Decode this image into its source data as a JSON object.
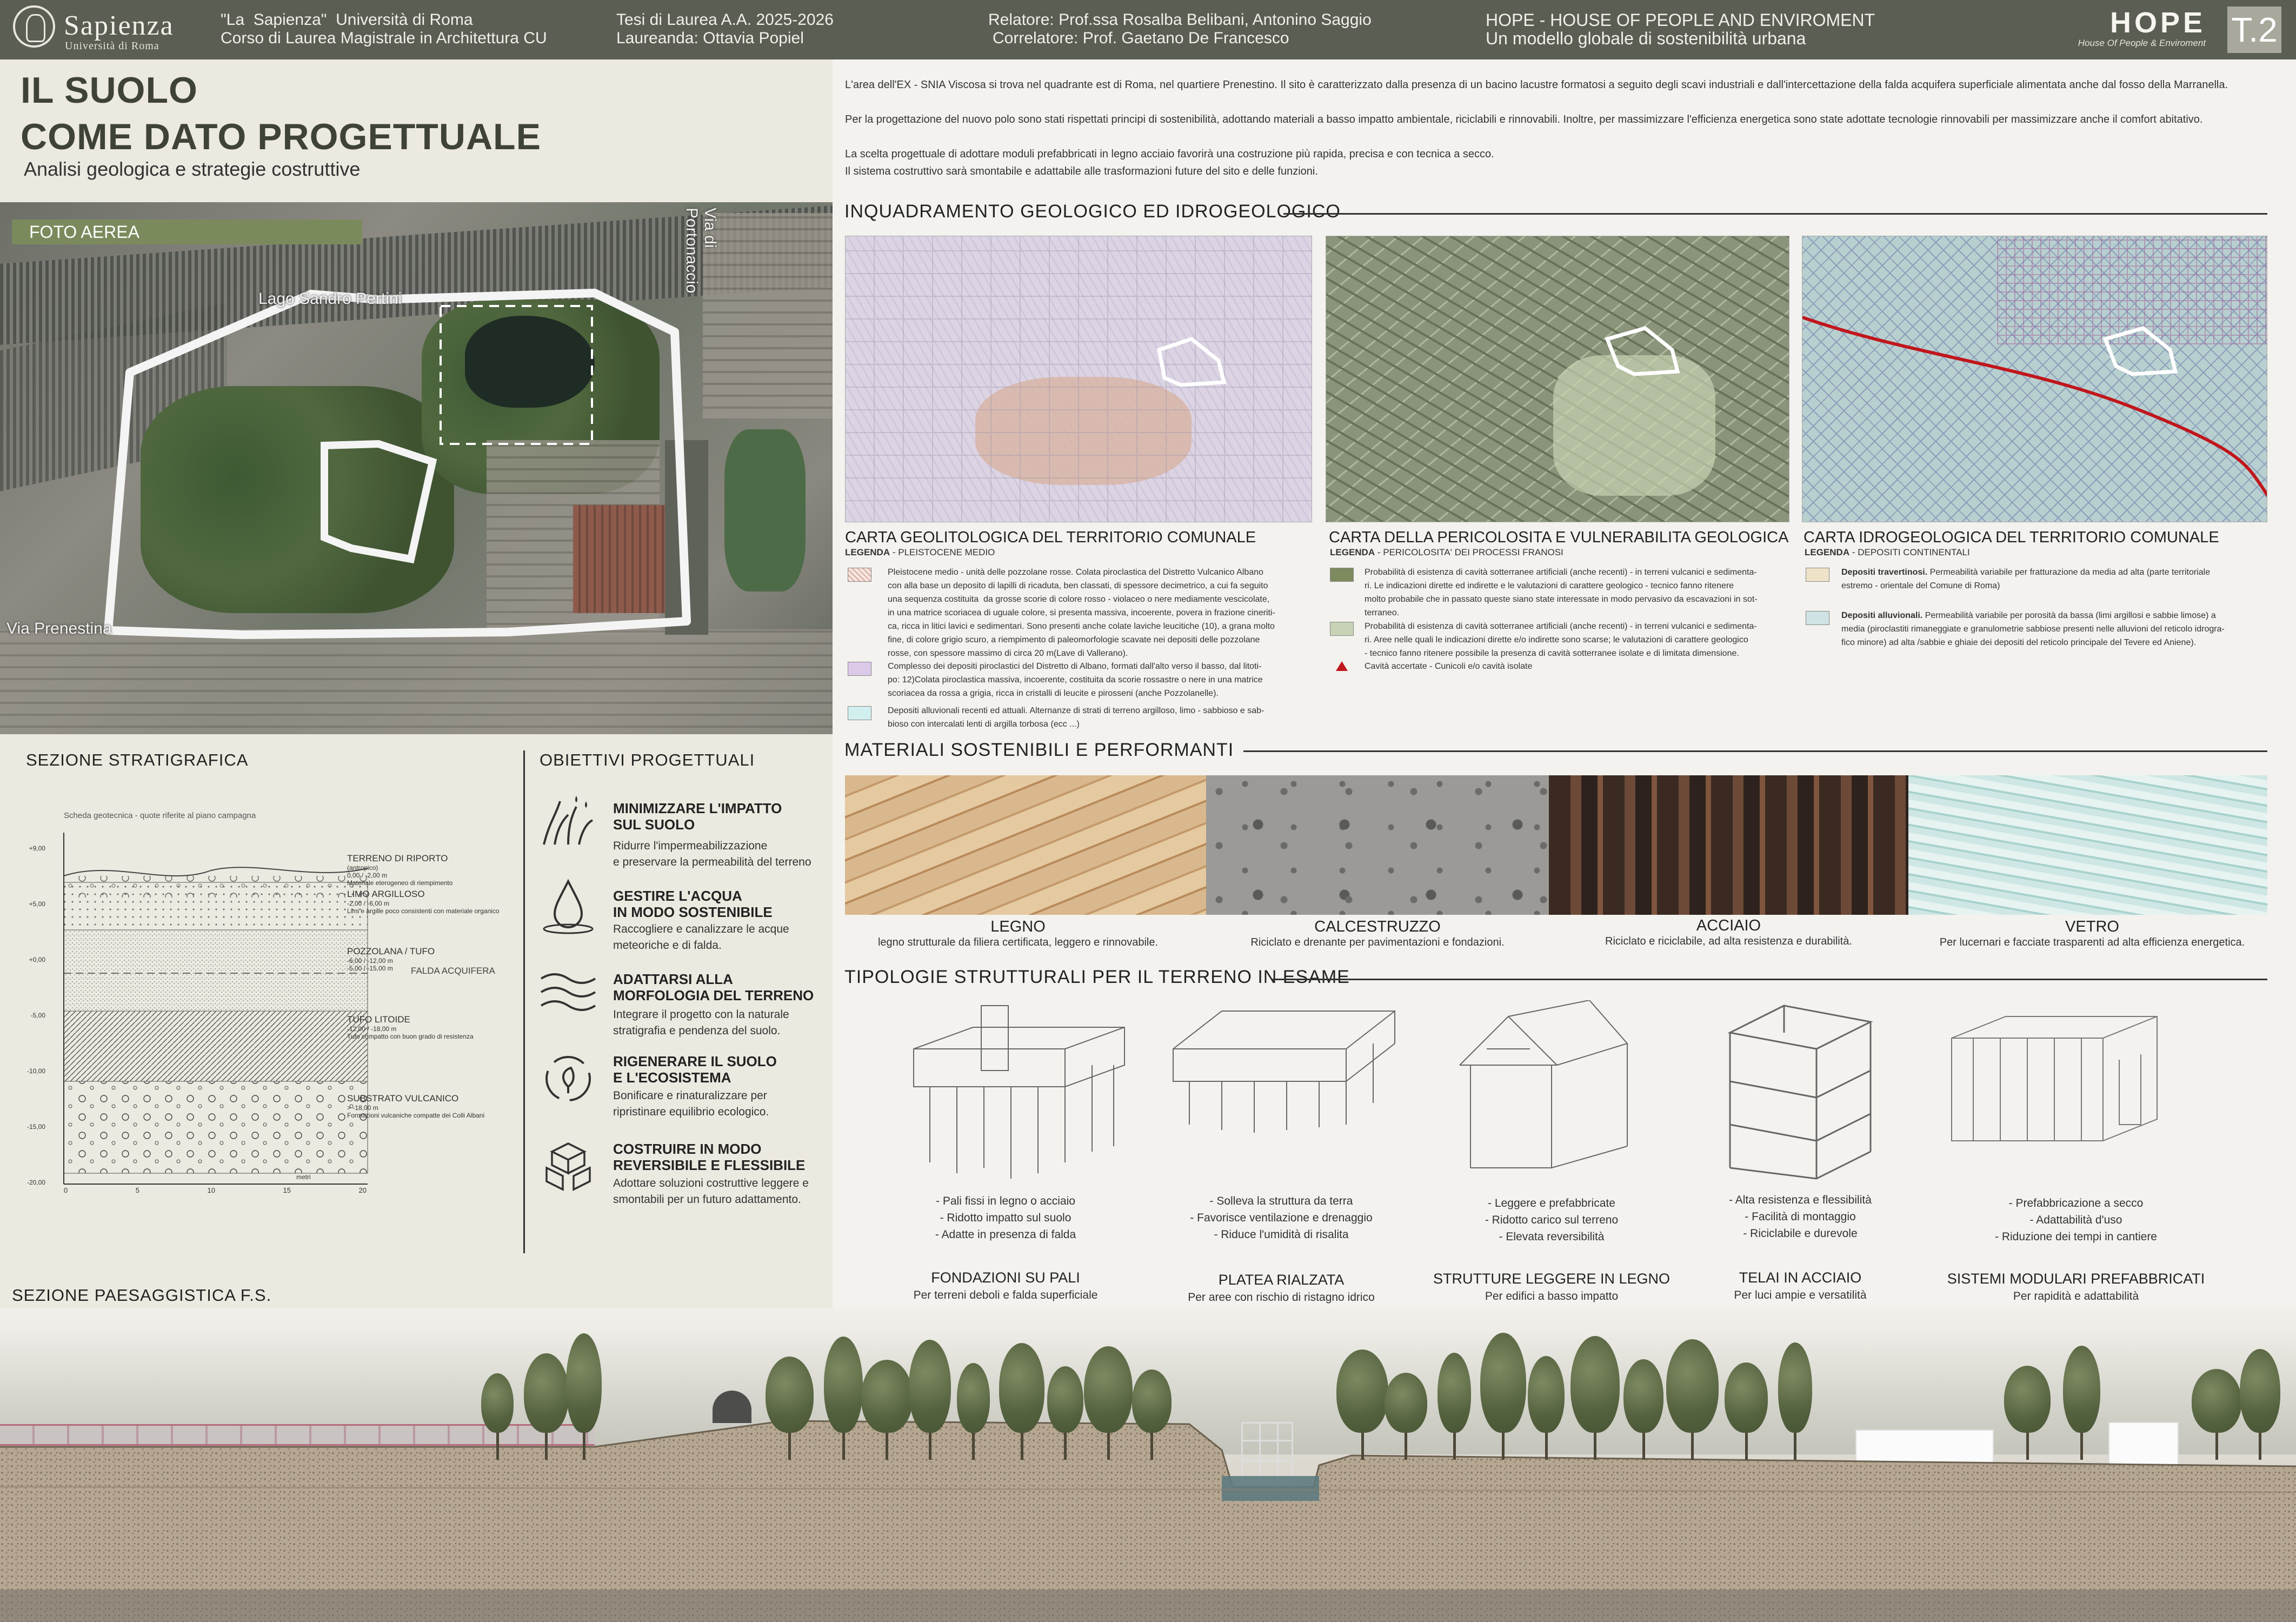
{
  "header": {
    "university_name": "Sapienza",
    "university_sub": "Università di Roma",
    "uni_line1": "\"La  Sapienza\"  Università di Roma",
    "uni_line2": "Corso di Laurea Magistrale in Architettura CU",
    "thesis_line1": "Tesi di Laurea A.A. 2025-2026",
    "thesis_line2": "Laureanda: Ottavia Popiel",
    "relatore_line1": "Relatore: Prof.ssa Rosalba Belibani, Antonino Saggio",
    "relatore_line2": "Correlatore: Prof. Gaetano De Francesco",
    "project_line1": "HOPE - HOUSE OF PEOPLE AND ENVIROMENT",
    "project_line2": "Un modello globale di sostenibilità urbana",
    "logo_word": "HOPE",
    "logo_tag": "House Of People & Enviroment",
    "board_code": "T.2"
  },
  "title": {
    "line1": "IL SUOLO",
    "line2": "COME DATO PROGETTUALE",
    "subtitle": "Analisi geologica e strategie  costruttive"
  },
  "aerial": {
    "label": "FOTO AEREA",
    "lake": "Lago Sandro Pertini",
    "via_portonaccio": "Via di Portonaccio",
    "via_prenestina": "Via Prenestina"
  },
  "stratigraphy": {
    "heading": "SEZIONE STRATIGRAFICA",
    "caption": "Scheda geotecnica - quote riferite al piano campagna",
    "axis_unit": "metri",
    "y_ticks": [
      "+9,00",
      "+5,00",
      "+0,00",
      "-5,00",
      "-10,00",
      "-15,00",
      "-20,00"
    ],
    "x_ticks": [
      "0",
      "5",
      "10",
      "15",
      "20"
    ],
    "water_label": "FALDA ACQUIFERA",
    "layers": [
      {
        "name": "TERRENO DI RIPORTO",
        "note": "(antropico)\n0,00 / -2,00 m\nMateriale eterogeneo di riempimento"
      },
      {
        "name": "LIMO ARGILLOSO",
        "note": "-2,00 / -6,00 m\nLimi e argille poco consistenti con materiale organico"
      },
      {
        "name": "POZZOLANA / TUFO",
        "note": "-6,00 / -12,00 m\n-5,00 / -15,00 m"
      },
      {
        "name": "TUFO LITOIDE",
        "note": "-12,00 / -18,00 m\nTufo compatto con buon grado di resistenza"
      },
      {
        "name": "SUBSTRATO VULCANICO",
        "note": "> -18,00 m\nFormazioni vulcaniche compatte dei Colli Albani"
      }
    ]
  },
  "objectives": {
    "heading": "OBIETTIVI PROGETTUALI",
    "items": [
      {
        "title": "MINIMIZZARE L'IMPATTO\nSUL SUOLO",
        "desc": "Ridurre l'impermeabilizzazione\ne preservare la permeabilità del terreno"
      },
      {
        "title": "GESTIRE L'ACQUA\nIN MODO SOSTENIBILE",
        "desc": "Raccogliere e canalizzare le acque\nmeteoriche e di falda."
      },
      {
        "title": "ADATTARSI ALLA\nMORFOLOGIA DEL TERRENO",
        "desc": "Integrare il progetto con la naturale\nstratigrafia e pendenza del suolo."
      },
      {
        "title": "RIGENERARE IL SUOLO\nE L'ECOSISTEMA",
        "desc": "Bonificare e rinaturalizzare per\nripristinare equilibrio ecologico."
      },
      {
        "title": "COSTRUIRE IN MODO\nREVERSIBILE E FLESSIBILE",
        "desc": "Adottare soluzioni costruttive leggere e\nsmontabili per un futuro adattamento."
      }
    ]
  },
  "landscape": {
    "heading": "SEZIONE PAESAGGISTICA F.S."
  },
  "intro": {
    "p1": "L'area dell'EX -  SNIA Viscosa si trova nel quadrante est di Roma, nel quartiere Prenestino. Il sito è caratterizzato dalla presenza di un bacino lacustre formatosi a seguito degli scavi industriali e dall'intercettazione della falda acquifera superficiale alimentata anche dal fosso della Marranella.",
    "p2": "Per la progettazione del nuovo polo sono stati rispettati principi di sostenibilità, adottando materiali a basso impatto ambientale, riciclabili e rinnovabili. Inoltre, per massimizzare l'efficienza energetica sono state adottate tecnologie rinnovabili per massimizzare anche il comfort abitativo.",
    "p3a": "La scelta progettuale di adottare moduli prefabbricati in legno acciaio favorirà una costruzione più rapida, precisa e con tecnica a secco.",
    "p3b": "Il sistema costruttivo sarà  smontabile e adattabile alle trasformazioni future del sito e delle funzioni."
  },
  "geology": {
    "heading": "INQUADRAMENTO GEOLOGICO ED IDROGEOLOGICO",
    "maps": [
      {
        "title": "CARTA GEOLITOLOGICA DEL TERRITORIO COMUNALE",
        "legend_head": "LEGENDA",
        "legend_sub": " - PLEISTOCENE MEDIO",
        "entries": [
          {
            "color": "#f0d6cf",
            "text": "Pleistocene medio - unità delle pozzolane rosse. Colata piroclastica del Distretto Vulcanico Albano\ncon alla base un deposito di lapilli di ricaduta, ben classati, di spessore decimetrico, a cui fa seguito\nuna sequenza costituita  da grosse scorie di colore rosso - violaceo o nere mediamente vescicolate,\nin una matrice scoriacea di uguale colore, si presenta massiva, incoerente, povera in frazione cineriti-\nca, ricca in litici lavici e sedimentari. Sono presenti anche colate laviche leucitiche (10), a grana molto\nfine, di colore grigio scuro, a riempimento di paleomorfologie scavate nei depositi delle pozzolane\nrosse, con spessore massimo di circa 20 m(Lave di Vallerano)."
          },
          {
            "color": "#dcc9ea",
            "text": "Complesso dei depositi piroclastici del Distretto di Albano, formati dall'alto verso il basso, dal litoti-\npo: 12)Colata piroclastica massiva, incoerente, costituita da scorie rossastre o nere in una matrice\nscoriacea da rossa a grigia, ricca in cristalli di leucite e pirosseni (anche Pozzolanelle)."
          },
          {
            "color": "#d2efef",
            "text": "Depositi alluvionali recenti ed attuali. Alternanze di strati di terreno argilloso, limo - sabbioso e sab-\nbioso con intercalati lenti di argilla torbosa (ecc ...)"
          }
        ]
      },
      {
        "title": "CARTA DELLA PERICOLOSITA E VULNERABILITA  GEOLOGICA",
        "legend_head": "LEGENDA",
        "legend_sub": " - PERICOLOSITA' DEI PROCESSI FRANOSI",
        "entries": [
          {
            "color": "#7d8a5e",
            "text": "Probabilità di esistenza di cavità sotterranee artificiali (anche recenti) - in terreni vulcanici e sedimenta-\nri. Le indicazioni dirette ed indirette e le valutazioni di carattere geologico - tecnico fanno ritenere\nmolto probabile che in passato queste siano state interessate in modo pervasivo da escavazioni in sot-\nterraneo."
          },
          {
            "color": "#c7d3b4",
            "text": "Probabilità di esistenza di cavità sotterranee artificiali (anche recenti) - in terreni vulcanici e sedimenta-\nri. Aree nelle quali le indicazioni dirette e/o indirette sono scarse; le valutazioni di carattere geologico\n- tecnico fanno ritenere possibile la presenza di cavità sotterranee isolate e di limitata dimensione."
          },
          {
            "color": "#c0161c",
            "text": "Cavità accertate - Cunicoli e/o cavità isolate"
          }
        ]
      },
      {
        "title": "CARTA IDROGEOLOGICA DEL TERRITORIO COMUNALE",
        "legend_head": "LEGENDA",
        "legend_sub": " - DEPOSITI CONTINENTALI",
        "entries": [
          {
            "color": "#eee3c8",
            "bold": "Depositi travertinosi.",
            "text": " Permeabilità variabile per fratturazione da media ad alta (parte territoriale\nestremo - orientale del Comune di Roma)"
          },
          {
            "color": "#cfe3e4",
            "bold": "Depositi alluvionali.",
            "text": " Permeabilità variabile per porosità da bassa (limi argillosi e sabbie limose) a\nmedia (piroclastiti rimaneggiate e granulometrie sabbiose presenti nelle alluvioni del reticolo idrogra-\nfico minore) ad alta /sabbie e ghiaie dei depositi del reticolo principale del Tevere ed Aniene)."
          }
        ]
      }
    ]
  },
  "materials": {
    "heading": "MATERIALI SOSTENIBILI E PERFORMANTI",
    "items": [
      {
        "name": "LEGNO",
        "desc": "legno strutturale da filiera certificata, leggero e rinnovabile."
      },
      {
        "name": "CALCESTRUZZO",
        "desc": "Riciclato e drenante per pavimentazioni e fondazioni."
      },
      {
        "name": "ACCIAIO",
        "desc": "Riciclato e riciclabile, ad alta resistenza e durabilità."
      },
      {
        "name": "VETRO",
        "desc": "Per lucernari e facciate trasparenti ad alta efficienza energetica."
      }
    ]
  },
  "typologies": {
    "heading": "TIPOLOGIE STRUTTURALI PER IL TERRENO IN ESAME",
    "items": [
      {
        "bullets": "- Pali fissi in legno o acciaio\n- Ridotto impatto sul suolo\n- Adatte in presenza di falda",
        "name": "FONDAZIONI SU PALI",
        "desc": "Per terreni deboli e falda superficiale"
      },
      {
        "bullets": "- Solleva la struttura da terra\n- Favorisce ventilazione e drenaggio\n- Riduce l'umidità di risalita",
        "name": "PLATEA RIALZATA",
        "desc": "Per aree con rischio di ristagno idrico"
      },
      {
        "bullets": "- Leggere e prefabbricate\n- Ridotto carico sul terreno\n- Elevata reversibilità",
        "name": "STRUTTURE LEGGERE IN LEGNO",
        "desc": "Per edifici a basso impatto"
      },
      {
        "bullets": "- Alta resistenza e flessibilità\n- Facilità di montaggio\n- Riciclabile e durevole",
        "name": "TELAI IN ACCIAIO",
        "desc": "Per luci ampie e versatilità"
      },
      {
        "bullets": "- Prefabbricazione a secco\n- Adattabilità d'uso\n- Riduzione dei tempi in cantiere",
        "name": "SISTEMI MODULARI PREFABBRICATI",
        "desc": "Per rapidità e adattabilità"
      }
    ]
  }
}
